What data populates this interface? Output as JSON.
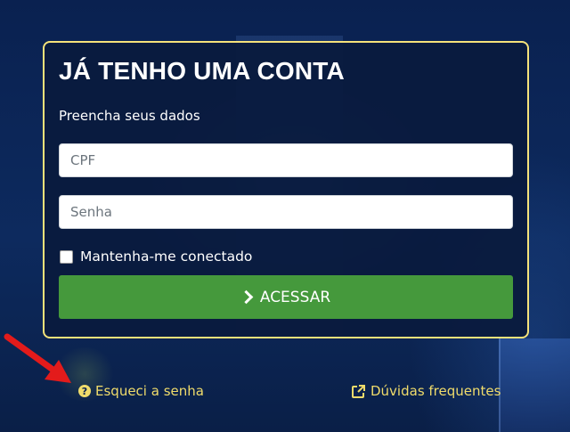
{
  "login": {
    "title": "JÁ TENHO UMA CONTA",
    "subtitle": "Preencha seus dados",
    "cpf_placeholder": "CPF",
    "senha_placeholder": "Senha",
    "remember_label": "Mantenha-me conectado",
    "submit_label": "ACESSAR"
  },
  "links": {
    "forgot_password": "Esqueci a senha",
    "faq": "Dúvidas frequentes"
  },
  "icons": {
    "forgot_password": "question-circle-icon",
    "faq": "external-link-icon",
    "submit": "chevron-right-icon",
    "annotation": "red-arrow"
  },
  "colors": {
    "accent_yellow": "#f0dc6b",
    "button_green": "#45993c",
    "card_border": "#f5e27a",
    "background": "#0b2350",
    "annotation_red": "#e31b1b"
  }
}
